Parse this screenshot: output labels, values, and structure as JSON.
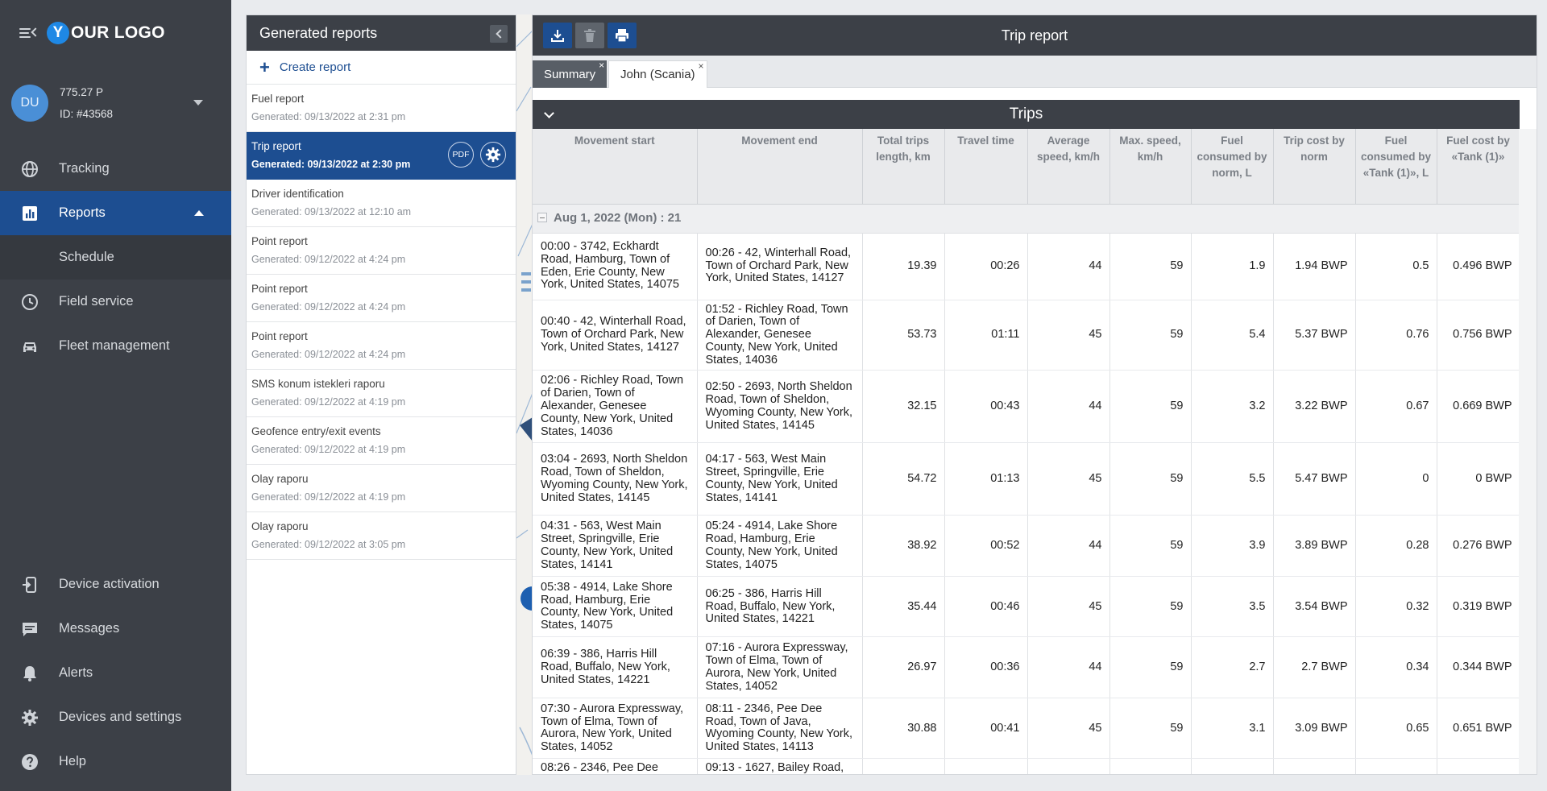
{
  "sidebar": {
    "logo_letter": "Y",
    "logo_text": "OUR LOGO",
    "account": {
      "initials": "DU",
      "balance": "775.27 P",
      "id": "ID: #43568"
    },
    "nav": [
      {
        "label": "Tracking",
        "icon": "globe-icon"
      },
      {
        "label": "Reports",
        "icon": "reports-icon",
        "active": true
      },
      {
        "label": "Schedule"
      },
      {
        "label": "Field service",
        "icon": "clock-icon"
      },
      {
        "label": "Fleet management",
        "icon": "car-icon"
      }
    ],
    "bottom_nav": [
      {
        "label": "Device activation",
        "icon": "device-activation-icon"
      },
      {
        "label": "Messages",
        "icon": "message-icon"
      },
      {
        "label": "Alerts",
        "icon": "bell-icon"
      },
      {
        "label": "Devices and settings",
        "icon": "gear-icon"
      },
      {
        "label": "Help",
        "icon": "help-icon"
      }
    ]
  },
  "reports_panel": {
    "title": "Generated reports",
    "create_label": "Create report",
    "pdf_label": "PDF",
    "items": [
      {
        "name": "Fuel report",
        "generated": "Generated: 09/13/2022 at 2:31 pm"
      },
      {
        "name": "Trip report",
        "generated": "Generated: 09/13/2022 at 2:30 pm",
        "selected": true
      },
      {
        "name": "Driver identification",
        "generated": "Generated: 09/13/2022 at 12:10 am"
      },
      {
        "name": "Point report",
        "generated": "Generated: 09/12/2022 at 4:24 pm"
      },
      {
        "name": "Point report",
        "generated": "Generated: 09/12/2022 at 4:24 pm"
      },
      {
        "name": "Point report",
        "generated": "Generated: 09/12/2022 at 4:24 pm"
      },
      {
        "name": "SMS konum istekleri raporu",
        "generated": "Generated: 09/12/2022 at 4:19 pm"
      },
      {
        "name": "Geofence entry/exit events",
        "generated": "Generated: 09/12/2022 at 4:19 pm"
      },
      {
        "name": "Olay raporu",
        "generated": "Generated: 09/12/2022 at 4:19 pm"
      },
      {
        "name": "Olay raporu",
        "generated": "Generated: 09/12/2022 at 3:05 pm"
      }
    ]
  },
  "report": {
    "title": "Trip report",
    "tabs": [
      {
        "label": "Summary",
        "close": "×"
      },
      {
        "label": "John (Scania)",
        "close": "×"
      }
    ],
    "section_title": "Trips",
    "columns": [
      "Movement start",
      "Movement end",
      "Total trips length, km",
      "Travel time",
      "Average speed, km/h",
      "Max. speed, km/h",
      "Fuel consumed by norm, L",
      "Trip cost by norm",
      "Fuel consumed by «Tank (1)», L",
      "Fuel cost by «Tank (1)»"
    ],
    "group_label": "Aug 1, 2022 (Mon) : 21",
    "rows": [
      [
        "00:00 - 3742, Eckhardt Road, Hamburg, Town of Eden, Erie County, New York, United States, 14075",
        "00:26 - 42, Winterhall Road, Town of Orchard Park, New York, United States, 14127",
        "19.39",
        "00:26",
        "44",
        "59",
        "1.9",
        "1.94 BWP",
        "0.5",
        "0.496 BWP"
      ],
      [
        "00:40 - 42, Winterhall Road, Town of Orchard Park, New York, United States, 14127",
        "01:52 - Richley Road, Town of Darien, Town of Alexander, Genesee County, New York, United States, 14036",
        "53.73",
        "01:11",
        "45",
        "59",
        "5.4",
        "5.37 BWP",
        "0.76",
        "0.756 BWP"
      ],
      [
        "02:06 - Richley Road, Town of Darien, Town of Alexander, Genesee County, New York, United States, 14036",
        "02:50 - 2693, North Sheldon Road, Town of Sheldon, Wyoming County, New York, United States, 14145",
        "32.15",
        "00:43",
        "44",
        "59",
        "3.2",
        "3.22 BWP",
        "0.67",
        "0.669 BWP"
      ],
      [
        "03:04 - 2693, North Sheldon Road, Town of Sheldon, Wyoming County, New York, United States, 14145",
        "04:17 - 563, West Main Street, Springville, Erie County, New York, United States, 14141",
        "54.72",
        "01:13",
        "45",
        "59",
        "5.5",
        "5.47 BWP",
        "0",
        "0 BWP"
      ],
      [
        "04:31 - 563, West Main Street, Springville, Erie County, New York, United States, 14141",
        "05:24 - 4914, Lake Shore Road, Hamburg, Erie County, New York, United States, 14075",
        "38.92",
        "00:52",
        "44",
        "59",
        "3.9",
        "3.89 BWP",
        "0.28",
        "0.276 BWP"
      ],
      [
        "05:38 - 4914, Lake Shore Road, Hamburg, Erie County, New York, United States, 14075",
        "06:25 - 386, Harris Hill Road, Buffalo, New York, United States, 14221",
        "35.44",
        "00:46",
        "45",
        "59",
        "3.5",
        "3.54 BWP",
        "0.32",
        "0.319 BWP"
      ],
      [
        "06:39 - 386, Harris Hill Road, Buffalo, New York, United States, 14221",
        "07:16 - Aurora Expressway, Town of Elma, Town of Aurora, New York, United States, 14052",
        "26.97",
        "00:36",
        "44",
        "59",
        "2.7",
        "2.7 BWP",
        "0.34",
        "0.344 BWP"
      ],
      [
        "07:30 - Aurora Expressway, Town of Elma, Town of Aurora, New York, United States, 14052",
        "08:11 - 2346, Pee Dee Road, Town of Java, Wyoming County, New York, United States, 14113",
        "30.88",
        "00:41",
        "45",
        "59",
        "3.1",
        "3.09 BWP",
        "0.65",
        "0.651 BWP"
      ],
      [
        "08:26 - 2346, Pee Dee",
        "09:13 - 1627, Bailey Road,",
        "",
        "",
        "",
        "",
        "",
        "",
        "",
        ""
      ]
    ]
  }
}
